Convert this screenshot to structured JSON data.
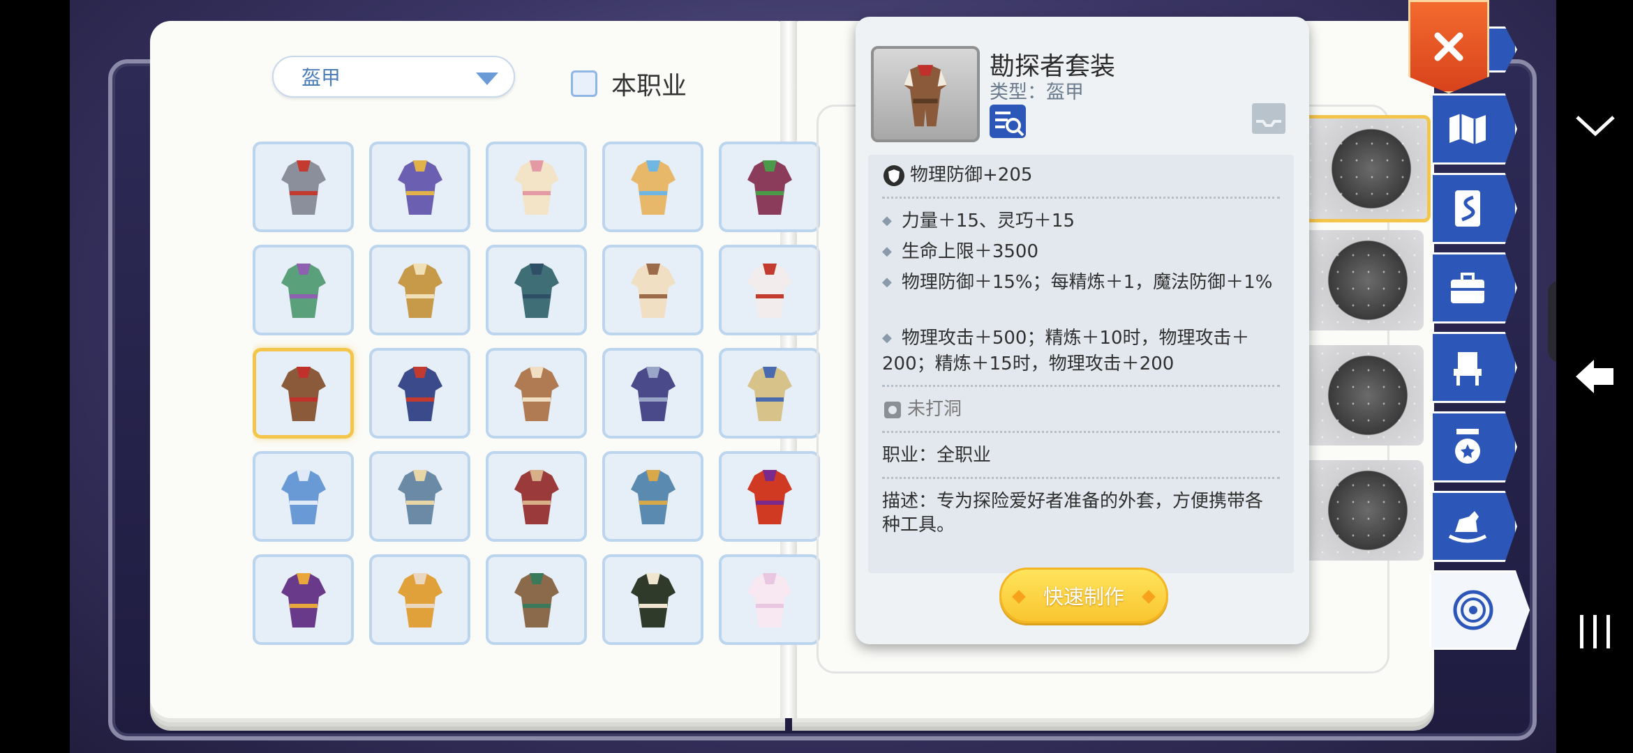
{
  "filter": {
    "category_value": "盔甲",
    "job_checkbox_label": "本职业"
  },
  "item": {
    "name": "勘探者套装",
    "type_line": "类型：盔甲",
    "base_stat": "物理防御+205",
    "effects": [
      "力量＋15、灵巧＋15",
      "生命上限＋3500",
      "物理防御＋15%；每精炼＋1，魔法防御＋1%",
      "物理攻击＋500；精炼＋10时，物理攻击＋200；精炼＋15时，物理攻击＋200"
    ],
    "socket": "未打洞",
    "job": "职业：全职业",
    "description": "描述：专为探险爱好者准备的外套，方便携带各种工具。",
    "craft_button": "快速制作"
  },
  "colors": {
    "selected_border": "#f4c54b",
    "tab_blue": "#2c57b8",
    "close_red": "#e0501f",
    "craft_yellow": "#f9c530"
  },
  "tabs": [
    "map-icon",
    "card-icon",
    "toolbox-icon",
    "chair-icon",
    "medal-icon",
    "rocking-horse-icon",
    "compass-icon"
  ],
  "grid": {
    "rows": 5,
    "columns": 5,
    "selected_index": 10
  }
}
